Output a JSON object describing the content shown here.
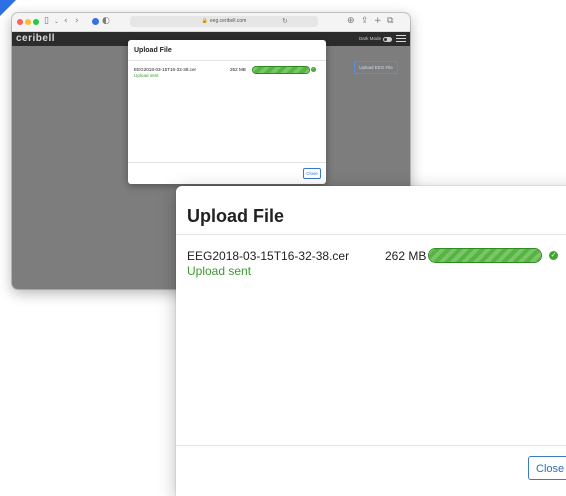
{
  "browser": {
    "url": "eeg.ceribell.com",
    "icons": [
      "sidebar-icon",
      "back-icon",
      "forward-icon",
      "extension-icon",
      "privacy-icon",
      "lock-icon",
      "reload-icon",
      "download-icon",
      "share-icon",
      "new-tab-icon",
      "tabs-icon"
    ]
  },
  "app": {
    "logo": "ceribell",
    "dark_mode_label": "Dark Mode",
    "upload_eeg_button": "Upload EEG File"
  },
  "modal": {
    "title": "Upload File",
    "file": {
      "name": "EEG2018-03-15T16-32-38.cer",
      "size": "262 MB",
      "status": "Upload sent",
      "progress": 1.0
    },
    "close_label": "Close"
  },
  "colors": {
    "accent": "#3b78c5",
    "success": "#3c9a2f",
    "progress": "#55b540",
    "app_bar": "#2c2c2c",
    "overlay": "#7d7d7d"
  }
}
